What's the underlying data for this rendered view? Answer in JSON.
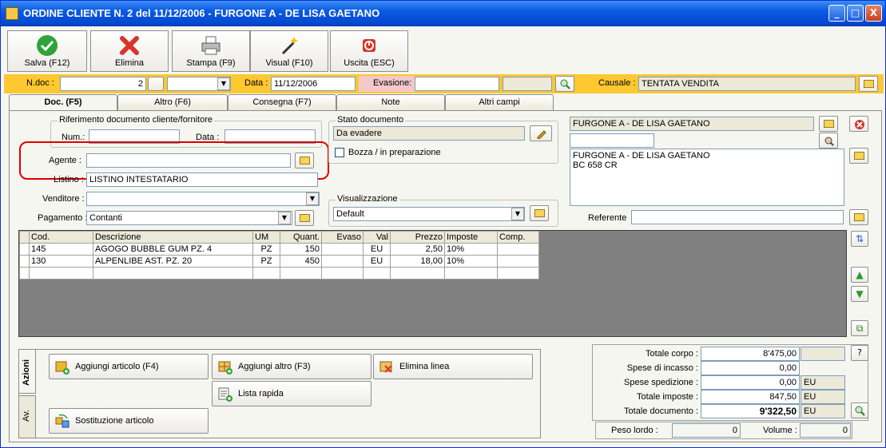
{
  "window": {
    "title": "ORDINE CLIENTE N. 2  del 11/12/2006 - FURGONE A - DE LISA GAETANO",
    "min": "_",
    "max": "□",
    "close": "X"
  },
  "toolbar": [
    {
      "label": "Salva (F12)",
      "icon": "check-icon"
    },
    {
      "label": "Elimina",
      "icon": "x-icon"
    },
    {
      "label": "Stampa (F9)",
      "icon": "printer-icon"
    },
    {
      "label": "Visual (F10)",
      "icon": "magic-wand-icon"
    },
    {
      "label": "Uscita (ESC)",
      "icon": "exit-icon"
    }
  ],
  "header": {
    "ndoc_label": "N.doc :",
    "ndoc_value": "2",
    "data_label": "Data :",
    "data_value": "11/12/2006",
    "evasione_label": "Evasione:",
    "evasione_value": "",
    "causale_label": "Causale :",
    "causale_value": "TENTATA VENDITA"
  },
  "tabs": [
    "Doc. (F5)",
    "Altro (F6)",
    "Consegna (F7)",
    "Note",
    "Altri campi"
  ],
  "doc": {
    "rif_title": "Riferimento documento cliente/fornitore",
    "num_label": "Num.:",
    "num_value": "",
    "data_label": "Data :",
    "data_value": "",
    "agente_label": "Agente :",
    "agente_value": "",
    "listino_label": "Listino :",
    "listino_value": "LISTINO INTESTATARIO",
    "venditore_label": "Venditore :",
    "venditore_value": "",
    "pagamento_label": "Pagamento :",
    "pagamento_value": "Contanti",
    "stato_title": "Stato documento",
    "stato_value": "Da evadere",
    "bozza_label": "Bozza / in preparazione",
    "vis_title": "Visualizzazione",
    "vis_value": "Default",
    "cliente_name": "FURGONE A - DE LISA GAETANO",
    "cliente_line2": "",
    "indirizzo_1": "FURGONE A - DE LISA GAETANO",
    "indirizzo_2": "BC 658 CR",
    "referente_label": "Referente",
    "referente_value": ""
  },
  "grid": {
    "columns": [
      "Cod.",
      "Descrizione",
      "UM",
      "Quant.",
      "Evaso",
      "Val",
      "Prezzo",
      "Imposte",
      "Comp."
    ],
    "rows": [
      [
        "145",
        "AGOGO BUBBLE GUM PZ. 4",
        "PZ",
        "150",
        "",
        "EU",
        "2,50",
        "10%",
        ""
      ],
      [
        "130",
        "ALPENLIBE AST. PZ. 20",
        "PZ",
        "450",
        "",
        "EU",
        "18,00",
        "10%",
        ""
      ],
      [
        "",
        "",
        "",
        "",
        "",
        "",
        "",
        "",
        ""
      ]
    ]
  },
  "actions": {
    "tab_azioni": "Azioni",
    "tab_av": "Av.",
    "aggiungi_articolo": "Aggiungi articolo (F4)",
    "aggiungi_altro": "Aggiungi altro (F3)",
    "elimina_linea": "Elimina linea",
    "lista_rapida": "Lista rapida",
    "sostituzione": "Sostituzione articolo"
  },
  "totals": {
    "corpo_label": "Totale corpo :",
    "corpo_value": "8'475,00",
    "incasso_label": "Spese di incasso :",
    "incasso_value": "0,00",
    "spedizione_label": "Spese spedizione :",
    "spedizione_value": "0,00",
    "spedizione_cur": "EU",
    "imposte_label": "Totale imposte :",
    "imposte_value": "847,50",
    "imposte_cur": "EU",
    "documento_label": "Totale documento :",
    "documento_value": "9'322,50",
    "documento_cur": "EU",
    "help": "?",
    "peso_label": "Peso lordo :",
    "peso_value": "0",
    "volume_label": "Volume :",
    "volume_value": "0"
  }
}
